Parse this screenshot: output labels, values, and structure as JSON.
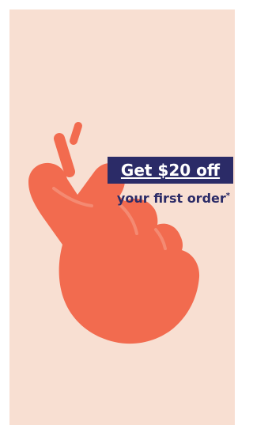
{
  "promo": {
    "headline": "Get $20 off",
    "subline": "your first order",
    "footnote_mark": "*"
  },
  "colors": {
    "background": "#f8dfd2",
    "accent": "#f26b4f",
    "navy": "#2b2b67"
  },
  "icons": {
    "graphic": "crossed-fingers-icon"
  }
}
